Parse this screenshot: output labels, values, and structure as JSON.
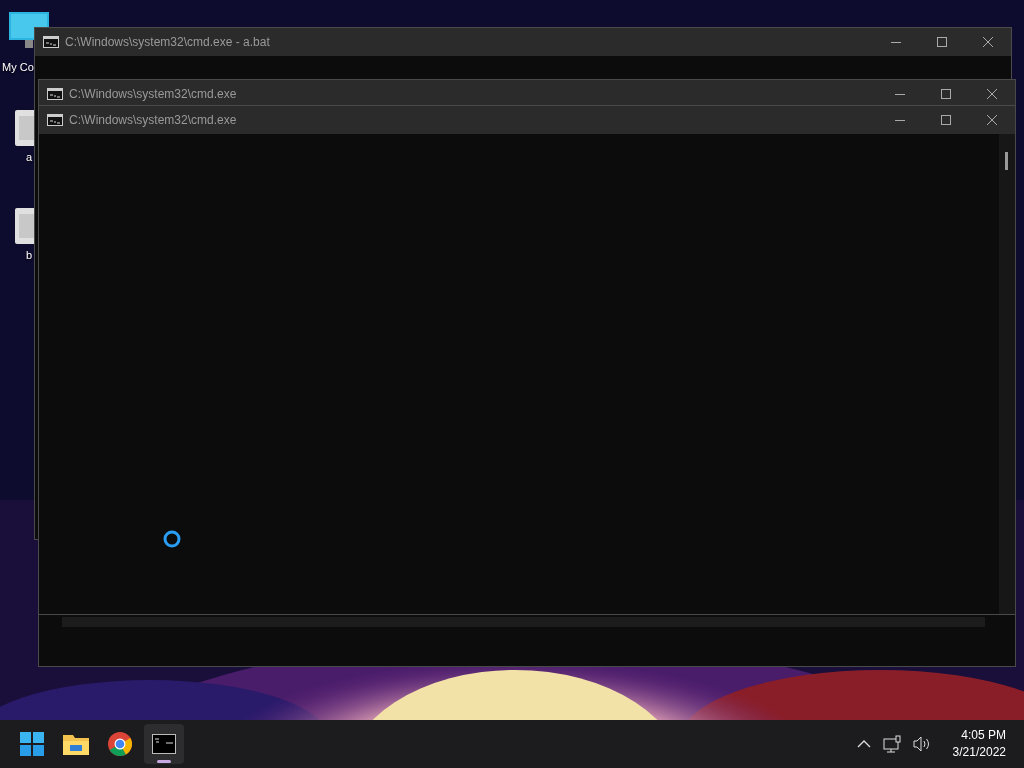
{
  "desktop": {
    "icons": [
      {
        "kind": "computer",
        "label": "My Co"
      },
      {
        "kind": "file",
        "label": "a"
      },
      {
        "kind": "file",
        "label": "b"
      }
    ]
  },
  "windows": [
    {
      "title": "C:\\Windows\\system32\\cmd.exe - a.bat"
    },
    {
      "title": "C:\\Windows\\system32\\cmd.exe"
    },
    {
      "title": "C:\\Windows\\system32\\cmd.exe"
    }
  ],
  "taskbar": {
    "apps": [
      {
        "kind": "start",
        "selected": false
      },
      {
        "kind": "explorer",
        "selected": false
      },
      {
        "kind": "chrome",
        "selected": false
      },
      {
        "kind": "terminal",
        "selected": true
      }
    ],
    "tray": {
      "time": "4:05 PM",
      "date": "3/21/2022"
    }
  }
}
